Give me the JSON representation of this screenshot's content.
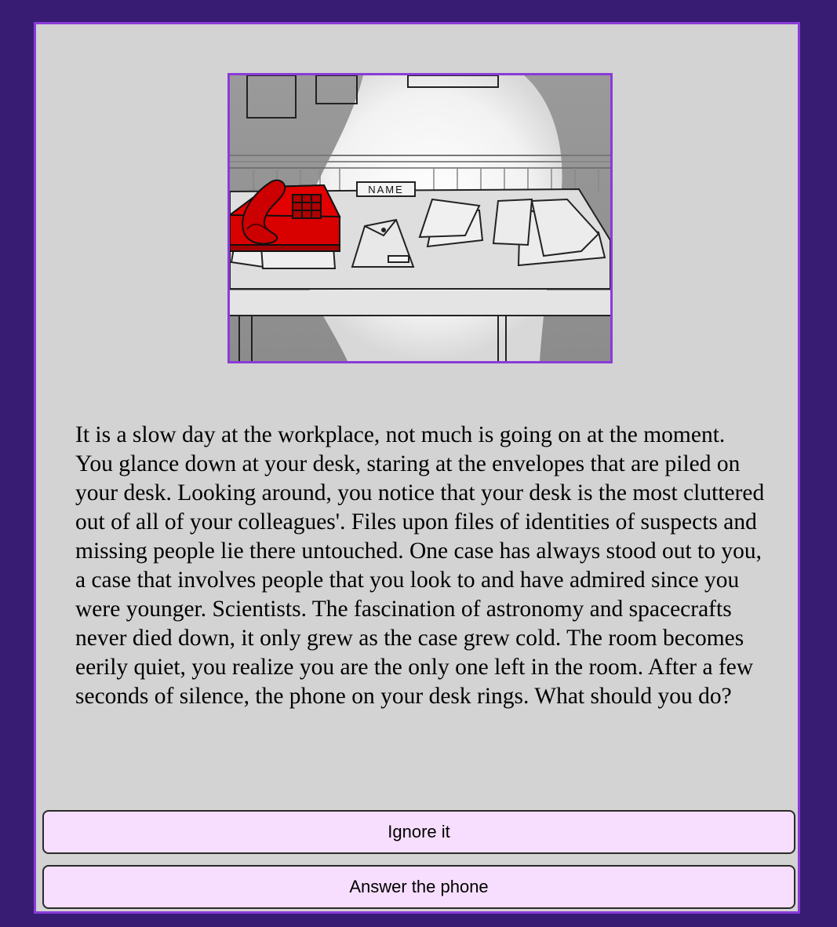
{
  "scene": {
    "image_icon": "office-desk-phone-illustration",
    "nameplate_text": "NAME",
    "colors": {
      "frame_border": "#8a3bd8",
      "phone_red": "#d90000",
      "page_background": "#381c74",
      "panel_background": "#d3d3d3",
      "button_background": "#f7defe"
    }
  },
  "story": {
    "text": "It is a slow day at the workplace, not much is going on at the moment. You glance down at your desk, staring at the envelopes that are piled on your desk. Looking around, you notice that your desk is the most cluttered out of all of your colleagues'. Files upon files of identities of suspects and missing people lie there untouched. One case has always stood out to you, a case that involves people that you look to and have admired since you were younger. Scientists. The fascination of astronomy and spacecrafts never died down, it only grew as the case grew cold. The room becomes eerily quiet, you realize you are the only one left in the room. After a few seconds of silence, the phone on your desk rings. What should you do?"
  },
  "choices": [
    {
      "label": "Ignore it"
    },
    {
      "label": "Answer the phone"
    }
  ]
}
